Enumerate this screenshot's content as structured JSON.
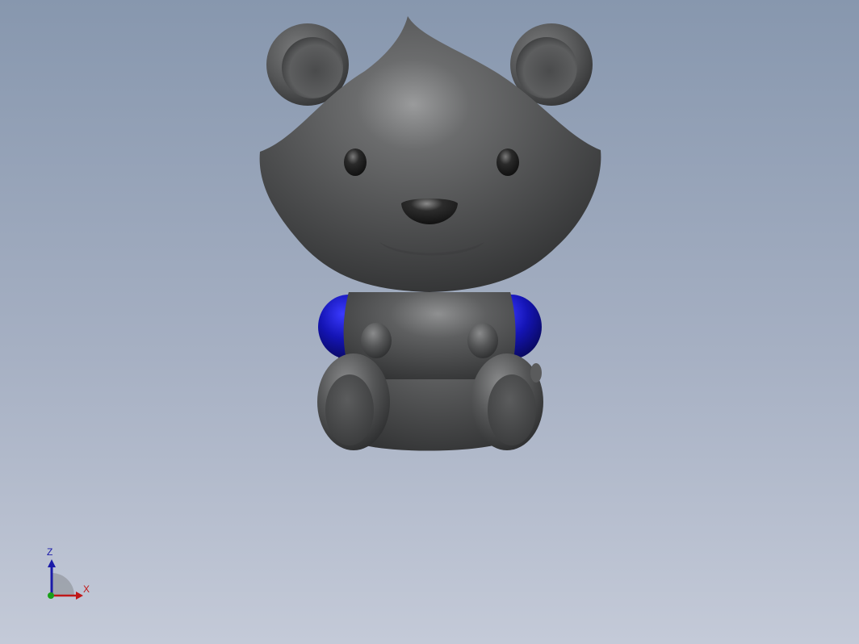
{
  "viewport": {
    "background_top": "#8797ae",
    "background_bottom": "#c4cad8"
  },
  "model": {
    "body_color": "#555657",
    "accent_color": "#1414b4",
    "eye_color": "#1e1e1e"
  },
  "triad": {
    "z_label": "Z",
    "x_label": "X",
    "z_color": "#1a1aa8",
    "x_color": "#c01818",
    "y_color": "#18a018"
  }
}
